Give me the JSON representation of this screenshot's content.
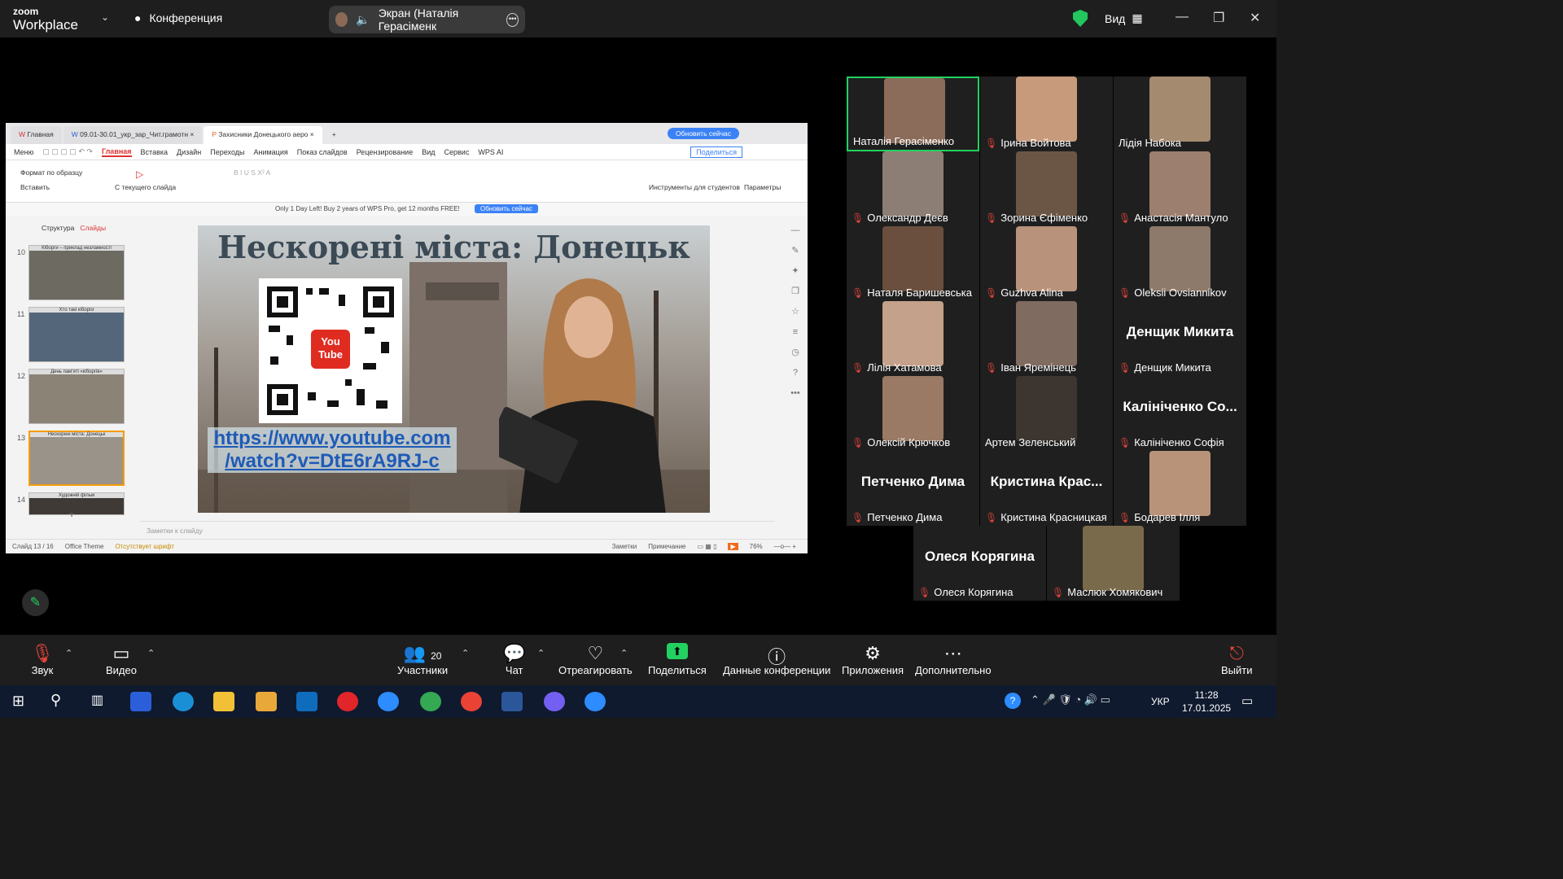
{
  "app": {
    "brand_top": "zoom",
    "brand_bottom": "Workplace",
    "meeting_label": "Конференция",
    "share_status": "Экран (Наталія Герасіменк",
    "view_label": "Вид"
  },
  "wps": {
    "tabs": [
      "Главная",
      "09.01-30.01_укр_зар_Чит.грамотн",
      "Захисники Донецького аеро"
    ],
    "update_button": "Обновить сейчас",
    "menu": [
      "Меню",
      "Главная",
      "Вставка",
      "Дизайн",
      "Переходы",
      "Анимация",
      "Показ слайдов",
      "Рецензирование",
      "Вид",
      "Сервис",
      "WPS AI"
    ],
    "share_label": "Поделиться",
    "ribbon": {
      "format_painter": "Формат по образцу",
      "paste": "Вставить",
      "from_current": "С текущего слайда",
      "students": "Инструменты для студентов",
      "params": "Параметры"
    },
    "promo_text": "Only 1 Day Left! Buy 2 years of WPS Pro, get 12 months FREE!",
    "promo_button": "Обновить сейчас",
    "pane_tabs": [
      "Структура",
      "Слайды"
    ],
    "thumbnails": [
      {
        "num": "10",
        "title": "Кіборги – приклад незламності"
      },
      {
        "num": "11",
        "title": "Хто такі кіборги"
      },
      {
        "num": "12",
        "title": "День пам'яті «кіборгів»"
      },
      {
        "num": "13",
        "title": "Нескорені міста: Донецьк"
      },
      {
        "num": "14",
        "title": "Художній фільм"
      }
    ],
    "slide_title": "Нескорені міста: Донецьк",
    "slide_link_line1": "https://www.youtube.com",
    "slide_link_line2": "/watch?v=DtE6rA9RJ-c",
    "yt_top": "You",
    "yt_bottom": "Tube",
    "notes_placeholder": "Заметки к слайду",
    "status": {
      "slide": "Слайд 13 / 16",
      "theme": "Office Theme",
      "font_missing": "Отсутствует шрифт",
      "notes": "Заметки",
      "comment": "Примечание",
      "zoom": "76%"
    }
  },
  "participants": [
    {
      "name": "Наталія Герасіменко",
      "muted": false,
      "speaking": true
    },
    {
      "name": "Ірина Войтова",
      "muted": true
    },
    {
      "name": "Лідія Набока",
      "muted": false
    },
    {
      "name": "Олександр Деєв",
      "muted": true
    },
    {
      "name": "Зорина  Єфіменко",
      "muted": true
    },
    {
      "name": "Анастасія Мантуло",
      "muted": true
    },
    {
      "name": "Наталя Баришевська",
      "muted": true
    },
    {
      "name": "Guzhva Alina",
      "muted": true
    },
    {
      "name": "Oleksii Ovsiannikov",
      "muted": true
    },
    {
      "name": "Лілія Хатамова",
      "muted": true
    },
    {
      "name": "Іван Яремінець",
      "muted": true
    },
    {
      "name": "Денщик Микита",
      "muted": true,
      "big": "Денщик Микита"
    },
    {
      "name": "Олексій Крючков",
      "muted": true
    },
    {
      "name": "Артем Зеленський",
      "muted": false
    },
    {
      "name": "Калініченко Софія",
      "muted": true,
      "big": "Калініченко Со..."
    },
    {
      "name": "Петченко Дима",
      "muted": true,
      "big": "Петченко Дима"
    },
    {
      "name": "Кристина Красницкая",
      "muted": true,
      "big": "Кристина  Крас..."
    },
    {
      "name": "Бодарев Ілля",
      "muted": true
    },
    {
      "name": "Олеся Корягина",
      "muted": true,
      "big": "Олеся Корягина"
    },
    {
      "name": "Маслюк Хомякович",
      "muted": true
    }
  ],
  "toolbar": {
    "audio": "Звук",
    "video": "Видео",
    "participants": "Участники",
    "participants_count": "20",
    "chat": "Чат",
    "react": "Отреагировать",
    "share": "Поделиться",
    "info": "Данные конференции",
    "apps": "Приложения",
    "more": "Дополнительно",
    "leave": "Выйти"
  },
  "taskbar": {
    "lang": "УКР",
    "time": "11:28",
    "date": "17.01.2025"
  },
  "colors": {
    "accent_green": "#23d160",
    "mute_red": "#e0453a",
    "wps_red": "#d33",
    "link_blue": "#1e5bb8"
  }
}
